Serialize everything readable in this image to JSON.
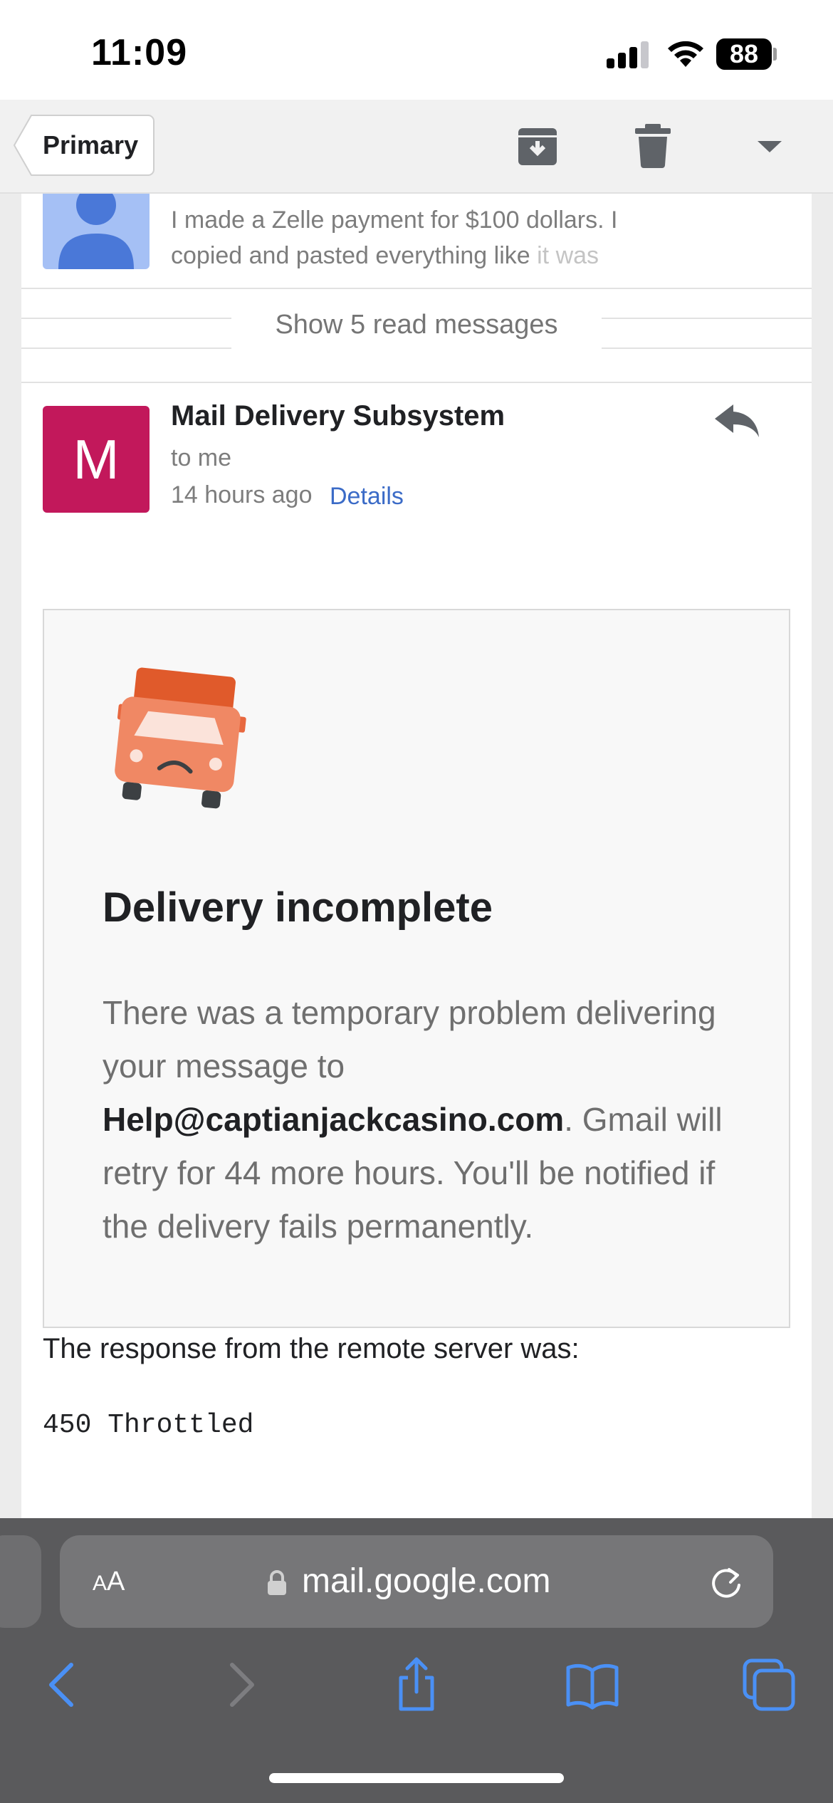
{
  "status_bar": {
    "time": "11:09",
    "battery": "88"
  },
  "toolbar": {
    "back_label": "Primary"
  },
  "previous_message": {
    "snippet_line1": "I made a Zelle payment for $100 dollars. I",
    "snippet_line2_main": "copied and pasted everything like ",
    "snippet_line2_fade": "it was"
  },
  "show_read": {
    "label": "Show 5 read messages"
  },
  "message": {
    "avatar_letter": "M",
    "sender": "Mail Delivery Subsystem",
    "recipient": "to me",
    "time_ago": "14 hours ago",
    "details_label": "Details"
  },
  "notice": {
    "title": "Delivery incomplete",
    "body_before": "There was a temporary problem delivering your message to ",
    "email": "Help@captianjackcasino.com",
    "body_after": ". Gmail will retry for 44 more hours. You'll be notified if the delivery fails permanently."
  },
  "remote": {
    "label": "The response from the remote server was:",
    "code": "450 Throttled"
  },
  "safari": {
    "aa_large": "A",
    "aa_small": "A",
    "url": "mail.google.com"
  },
  "colors": {
    "sender_avatar": "#c2185b",
    "prev_avatar": "#a5c0f5",
    "link": "#3b6bc7",
    "truck": "#e8683f",
    "safari_blue": "#4a90f5"
  }
}
